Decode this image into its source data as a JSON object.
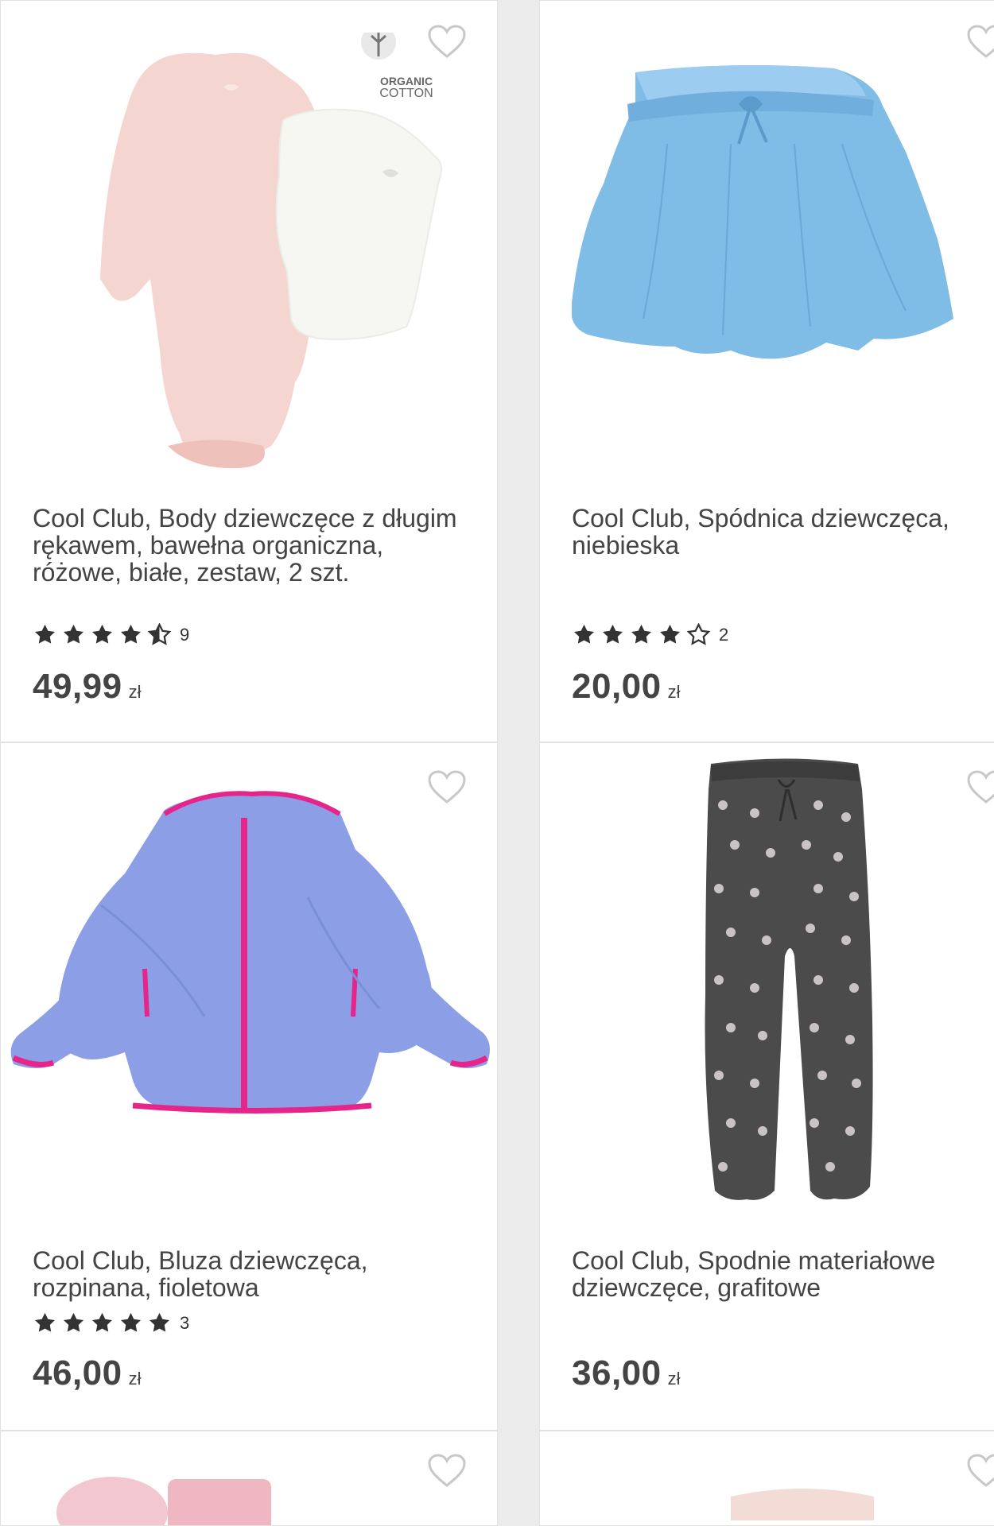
{
  "colors": {
    "accent_heart": "#c8c8c8",
    "star": "#333333",
    "text": "#444444"
  },
  "products": [
    {
      "title": "Cool Club, Body dziewczęce z długim rękawem, bawełna organiczna, różowe, białe, zestaw, 2 szt.",
      "rating": 4.5,
      "rating_count": "9",
      "price": "49,99",
      "currency": "zł",
      "badge_line1": "ORGANIC",
      "badge_line2": "COTTON",
      "image_icon": "bodysuit-icon"
    },
    {
      "title": "Cool Club, Spódnica dziewczęca, niebieska",
      "rating": 4,
      "rating_count": "2",
      "price": "20,00",
      "currency": "zł",
      "image_icon": "skirt-icon"
    },
    {
      "title": "Cool Club, Bluza dziewczęca, rozpinana, fioletowa",
      "rating": 5,
      "rating_count": "3",
      "price": "46,00",
      "currency": "zł",
      "image_icon": "fleece-jacket-icon"
    },
    {
      "title": "Cool Club, Spodnie materiałowe dziewczęce, grafitowe",
      "price": "36,00",
      "currency": "zł",
      "image_icon": "pants-icon"
    }
  ]
}
